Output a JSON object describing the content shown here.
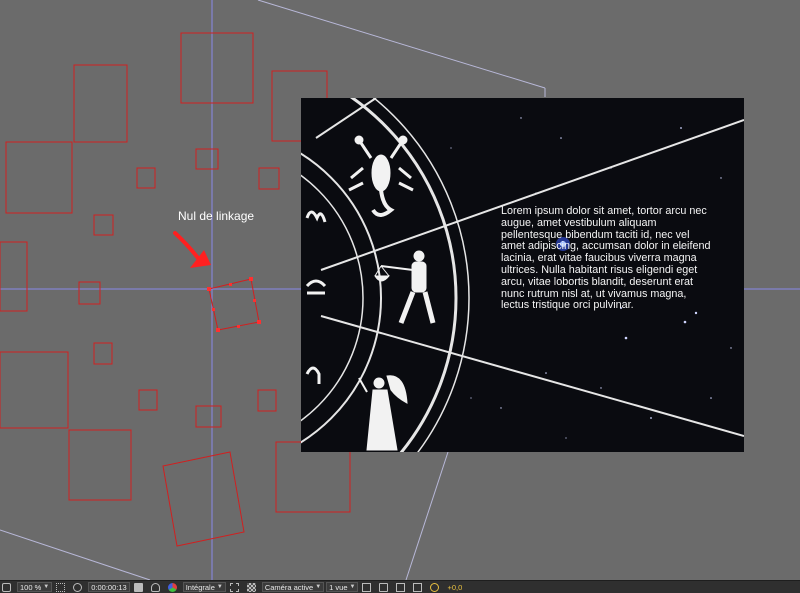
{
  "annotation": {
    "label": "Nul de linkage",
    "arrow_color": "#ff2020"
  },
  "composition": {
    "text": "Lorem ipsum dolor sit amet, tortor arcu nec\naugue, amet vestibulum aliquam\npellentesque bibendum taciti id, nec vel\namet adipiscing, accumsan dolor in eleifend\nlacinia, erat vitae faucibus viverra magna\nultrices. Nulla habitant risus eligendi eget\narcu, vitae lobortis blandit, deserunt erat\nnunc rutrum nisl at, ut vivamus magna,\nlectus tristique orci pulvinar.",
    "zodiac_symbols": [
      "scorpio-sign",
      "libra-sign",
      "virgo-sign"
    ]
  },
  "colors": {
    "viewer_bg": "#6b6b6b",
    "layer_outline": "#d02020",
    "guide": "#8a8ae8",
    "toolbar_bg": "#2f2f2f"
  },
  "toolbar": {
    "zoom": "100 %",
    "timecode": "0:00:00:13",
    "resolution": "Intégrale",
    "camera": "Caméra active",
    "view": "1 vue",
    "exposure": "+0,0"
  }
}
